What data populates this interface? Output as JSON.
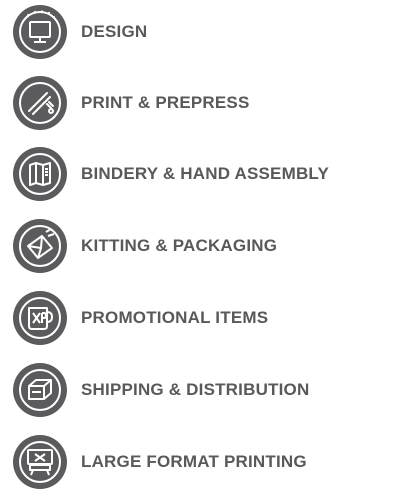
{
  "colors": {
    "badge": "#5b5b5d",
    "icon": "#ffffff",
    "label": "#58595b"
  },
  "services": [
    {
      "label": "DESIGN",
      "icon": "monitor-icon"
    },
    {
      "label": "PRINT & PREPRESS",
      "icon": "print-roller-icon"
    },
    {
      "label": "BINDERY & HAND ASSEMBLY",
      "icon": "folded-map-icon"
    },
    {
      "label": "KITTING & PACKAGING",
      "icon": "envelope-icon"
    },
    {
      "label": "PROMOTIONAL ITEMS",
      "icon": "mug-icon"
    },
    {
      "label": "SHIPPING & DISTRIBUTION",
      "icon": "box-icon"
    },
    {
      "label": "LARGE FORMAT PRINTING",
      "icon": "large-format-printer-icon"
    }
  ]
}
